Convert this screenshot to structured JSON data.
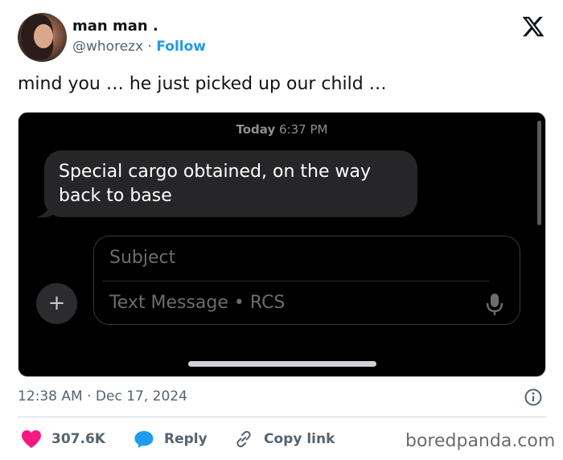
{
  "author": {
    "name": "man man .",
    "handle": "@whorezx",
    "separator": "·",
    "follow_label": "Follow",
    "logo_icon": "x-logo-icon"
  },
  "tweet": {
    "text": "mind you … he just picked up our child …",
    "date_time": "12:38 AM · Dec 17, 2024"
  },
  "media": {
    "timestamp_day": "Today",
    "timestamp_time": "6:37 PM",
    "message": "Special cargo obtained, on the way back to base",
    "compose": {
      "subject_placeholder": "Subject",
      "text_placeholder": "Text Message • RCS",
      "add_icon": "plus-icon",
      "mic_icon": "mic-icon"
    }
  },
  "actions": {
    "likes": "307.6K",
    "reply_label": "Reply",
    "copy_link_label": "Copy link"
  },
  "watermark": "boredpanda.com",
  "colors": {
    "accent": "#1d9bf0",
    "like": "#f91880",
    "text": "#0f1419",
    "muted": "#536471"
  }
}
